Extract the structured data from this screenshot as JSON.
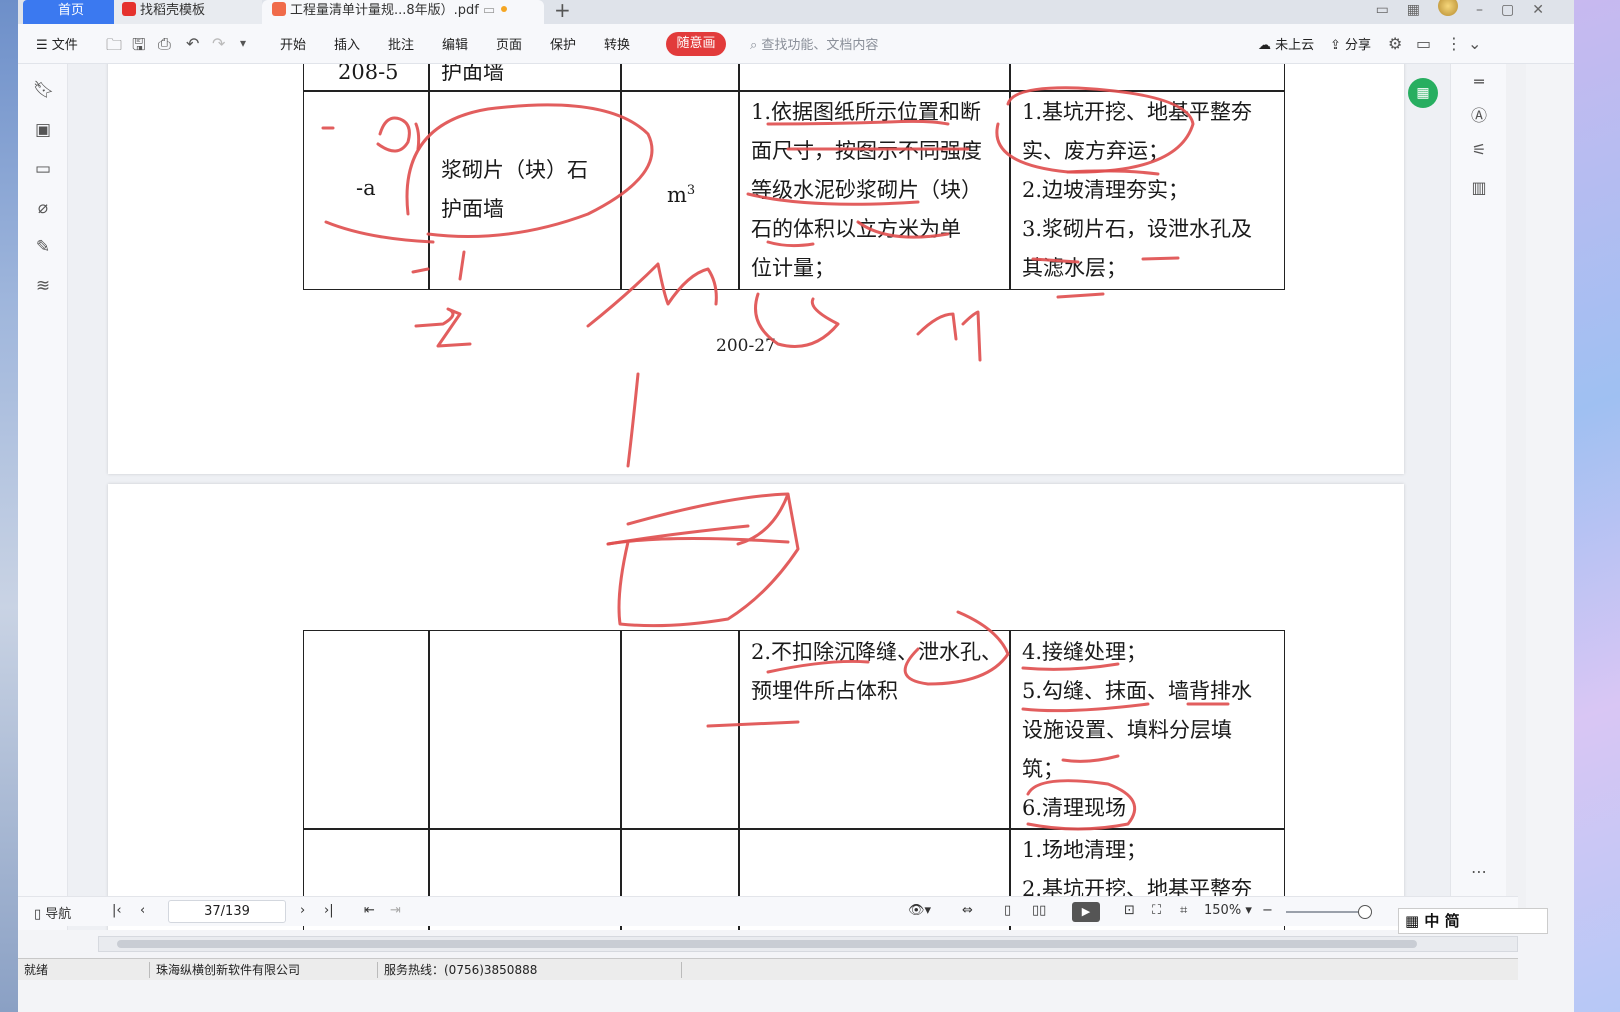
{
  "tabs": {
    "home": "首页",
    "template": "找稻壳模板",
    "document": "工程量清单计量规...8年版）.pdf",
    "add": "+"
  },
  "toolbar": {
    "file": "文件",
    "start": "开始",
    "insert": "插入",
    "annotate": "批注",
    "edit": "编辑",
    "page": "页面",
    "protect": "保护",
    "convert": "转换",
    "freehand": "随意画",
    "search_placeholder": "查找功能、文档内容",
    "cloud": "未上云",
    "share": "分享"
  },
  "table_top": {
    "code": "208-5",
    "name": "护面墙",
    "sub_code": "-a",
    "sub_name_l1": "浆砌片（块）石",
    "sub_name_l2": "护面墙",
    "unit": "m",
    "unit_sup": "3",
    "rule_lines": [
      "1.依据图纸所示位置和断",
      "面尺寸，按图示不同强度",
      "等级水泥砂浆砌片（块）",
      "石的体积以立方米为单",
      "位计量；"
    ],
    "work_lines": [
      "1.基坑开挖、地基平整夯",
      "实、废方弃运；",
      "2.边坡清理夯实；",
      "3.浆砌片石，设泄水孔及",
      "其滤水层；"
    ]
  },
  "page_number": "200-27",
  "table_bottom": {
    "rule_lines": [
      "2.不扣除沉降缝、泄水孔、",
      "预埋件所占体积"
    ],
    "work_lines": [
      "4.接缝处理；",
      "5.勾缝、抹面、墙背排水",
      "设施设置、填料分层填",
      "筑；",
      "6.清理现场"
    ],
    "next_lines": [
      "1.场地清理；",
      "2.基坑开挖、地基平整夯"
    ]
  },
  "statusbar": {
    "nav": "导航",
    "page_indicator": "37/139",
    "zoom": "150%"
  },
  "ime": "中 简",
  "window_status": {
    "ready": "就绪",
    "company": "珠海纵横创新软件有限公司",
    "hotline": "服务热线：(0756)3850888"
  }
}
